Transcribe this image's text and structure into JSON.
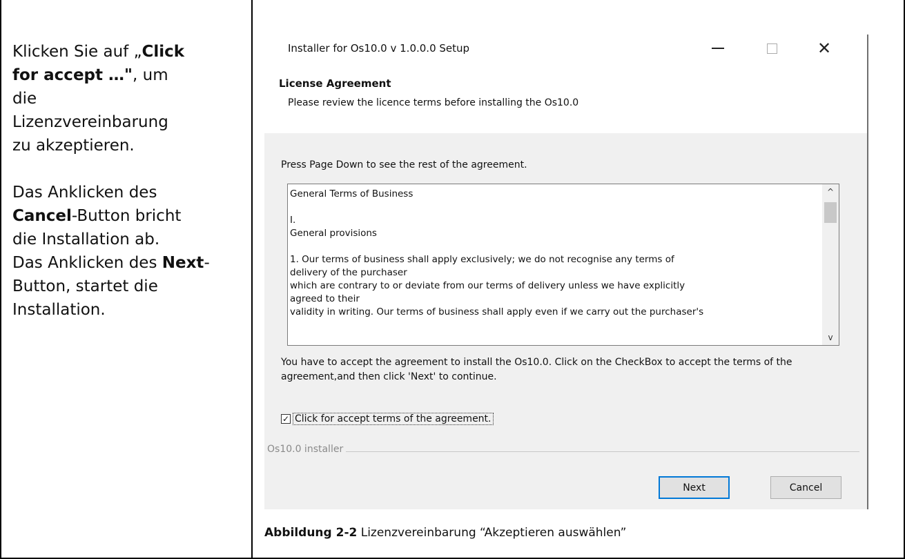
{
  "instructions": {
    "line1_pre": "Klicken Sie auf „",
    "line1_bold": "Click",
    "line2_bold": "for accept …\"",
    "line2_post": ", um",
    "line3": "die",
    "line4": "Lizenzvereinbarung",
    "line5": "zu akzeptieren.",
    "line6": "Das Anklicken des",
    "line7_bold": "Cancel",
    "line7_post": "-Button bricht",
    "line8": "die Installation ab.",
    "line9_pre": "Das Anklicken des ",
    "line9_bold": "Next",
    "line9_post": "-",
    "line10": "Button, startet die",
    "line11": "Installation."
  },
  "window": {
    "title": "Installer for Os10.0 v 1.0.0.0 Setup",
    "close_glyph": "✕"
  },
  "header": {
    "title": "License Agreement",
    "subtitle": "Please review the licence terms before installing the Os10.0"
  },
  "body": {
    "press_text": "Press Page Down to see the rest of the agreement.",
    "license_text": "General Terms of Business\n\nI.\nGeneral provisions\n\n1. Our terms of business shall apply exclusively; we do not recognise any terms of\ndelivery of the purchaser\nwhich are contrary to or deviate from our terms of delivery unless we have explicitly\nagreed to their\nvalidity in writing. Our terms of business shall apply even if we carry out the purchaser's",
    "scroll_up_glyph": "^",
    "scroll_down_glyph": "v",
    "accept_info": "You have to accept the agreement to install the Os10.0. Click on the CheckBox to accept the terms of the agreement,and then  click 'Next' to continue.",
    "checkbox_label": "Click for accept terms of the agreement.",
    "checkbox_checked": true,
    "checkbox_glyph": "✓",
    "group_label": "Os10.0 installer"
  },
  "buttons": {
    "next": "Next",
    "cancel": "Cancel"
  },
  "caption": {
    "bold": "Abbildung 2-2",
    "text": " Lizenzvereinbarung “Akzeptieren auswählen”"
  }
}
